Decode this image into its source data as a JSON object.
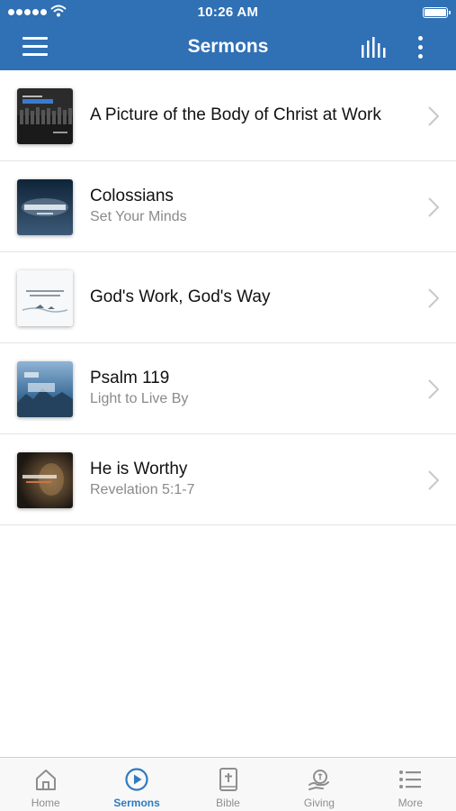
{
  "status_bar": {
    "time": "10:26 AM",
    "signal_icon": "signal-dots-icon",
    "wifi_icon": "wifi-icon",
    "battery_icon": "battery-icon"
  },
  "nav_bar": {
    "title": "Sermons",
    "color": "#3070b4",
    "left_icon": "hamburger-menu-icon",
    "right_icons": [
      "bar-chart-icon",
      "vertical-dots-icon"
    ]
  },
  "sermons": [
    {
      "title": "A Picture of the Body of Christ at Work",
      "subtitle": ""
    },
    {
      "title": "Colossians",
      "subtitle": "Set Your Minds"
    },
    {
      "title": "God's Work, God's Way",
      "subtitle": ""
    },
    {
      "title": "Psalm 119",
      "subtitle": "Light to Live By"
    },
    {
      "title": "He is Worthy",
      "subtitle": "Revelation 5:1-7"
    }
  ],
  "tab_bar": {
    "active_color": "#2f7ac0",
    "tabs": [
      {
        "label": "Home",
        "icon": "home-icon",
        "active": false
      },
      {
        "label": "Sermons",
        "icon": "play-circle-icon",
        "active": true
      },
      {
        "label": "Bible",
        "icon": "bible-icon",
        "active": false
      },
      {
        "label": "Giving",
        "icon": "giving-icon",
        "active": false
      },
      {
        "label": "More",
        "icon": "list-icon",
        "active": false
      }
    ]
  }
}
